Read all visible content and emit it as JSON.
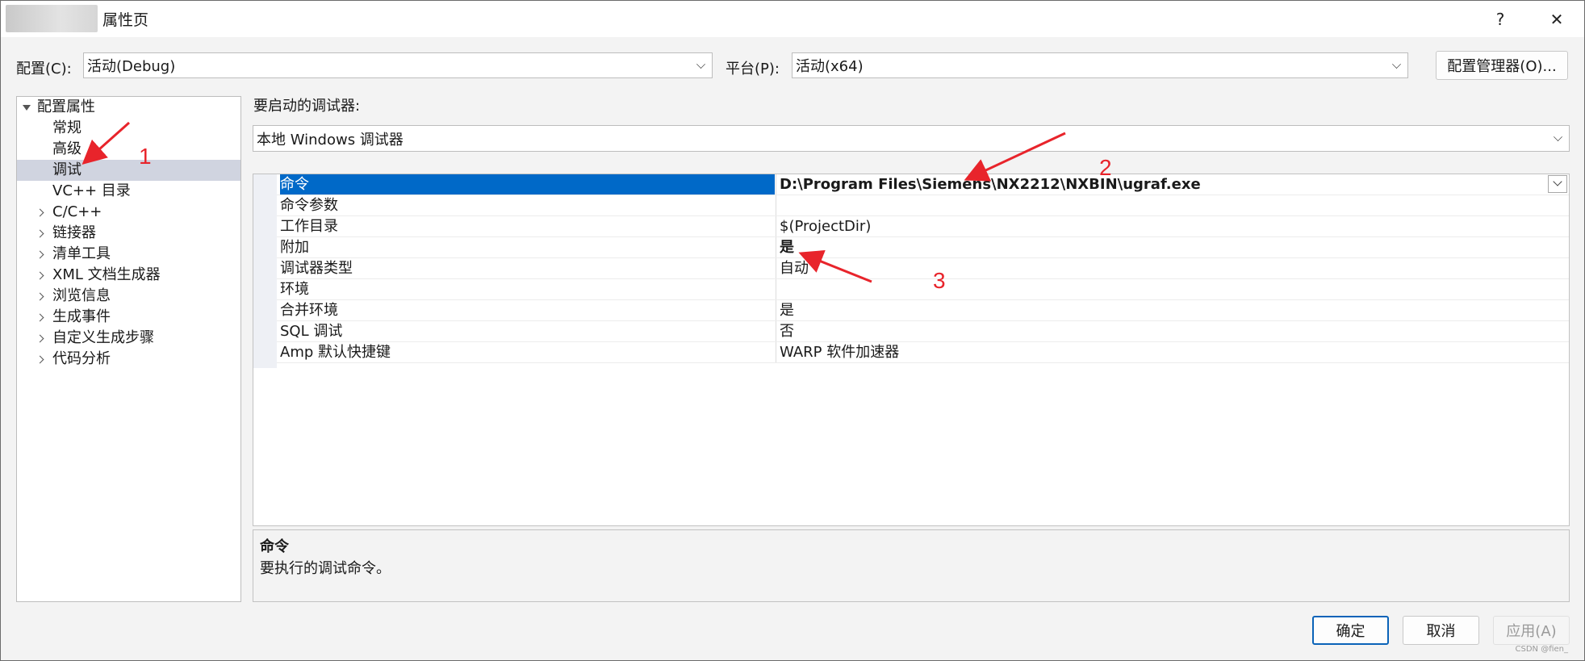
{
  "window": {
    "title": "属性页",
    "help_glyph": "?",
    "close_glyph": "✕"
  },
  "config": {
    "label": "配置(C):",
    "value": "活动(Debug)",
    "platform_label": "平台(P):",
    "platform_value": "活动(x64)",
    "manager_button": "配置管理器(O)..."
  },
  "tree": {
    "root": "配置属性",
    "items": [
      {
        "label": "常规",
        "expandable": false
      },
      {
        "label": "高级",
        "expandable": false
      },
      {
        "label": "调试",
        "expandable": false,
        "selected": true
      },
      {
        "label": "VC++ 目录",
        "expandable": false
      },
      {
        "label": "C/C++",
        "expandable": true
      },
      {
        "label": "链接器",
        "expandable": true
      },
      {
        "label": "清单工具",
        "expandable": true
      },
      {
        "label": "XML 文档生成器",
        "expandable": true
      },
      {
        "label": "浏览信息",
        "expandable": true
      },
      {
        "label": "生成事件",
        "expandable": true
      },
      {
        "label": "自定义生成步骤",
        "expandable": true
      },
      {
        "label": "代码分析",
        "expandable": true
      }
    ]
  },
  "debugger": {
    "label": "要启动的调试器:",
    "value": "本地 Windows 调试器"
  },
  "properties": [
    {
      "name": "命令",
      "value": "D:\\Program Files\\Siemens\\NX2212\\NXBIN\\ugraf.exe",
      "bold": true,
      "selected": true
    },
    {
      "name": "命令参数",
      "value": ""
    },
    {
      "name": "工作目录",
      "value": "$(ProjectDir)"
    },
    {
      "name": "附加",
      "value": "是",
      "bold": true
    },
    {
      "name": "调试器类型",
      "value": "自动"
    },
    {
      "name": "环境",
      "value": ""
    },
    {
      "name": "合并环境",
      "value": "是"
    },
    {
      "name": "SQL 调试",
      "value": "否"
    },
    {
      "name": "Amp 默认快捷键",
      "value": "WARP 软件加速器"
    }
  ],
  "description": {
    "title": "命令",
    "text": "要执行的调试命令。"
  },
  "buttons": {
    "ok": "确定",
    "cancel": "取消",
    "apply": "应用(A)"
  },
  "annotations": {
    "n1": "1",
    "n2": "2",
    "n3": "3",
    "color": "#e8242b"
  },
  "watermark": "CSDN @fien_"
}
